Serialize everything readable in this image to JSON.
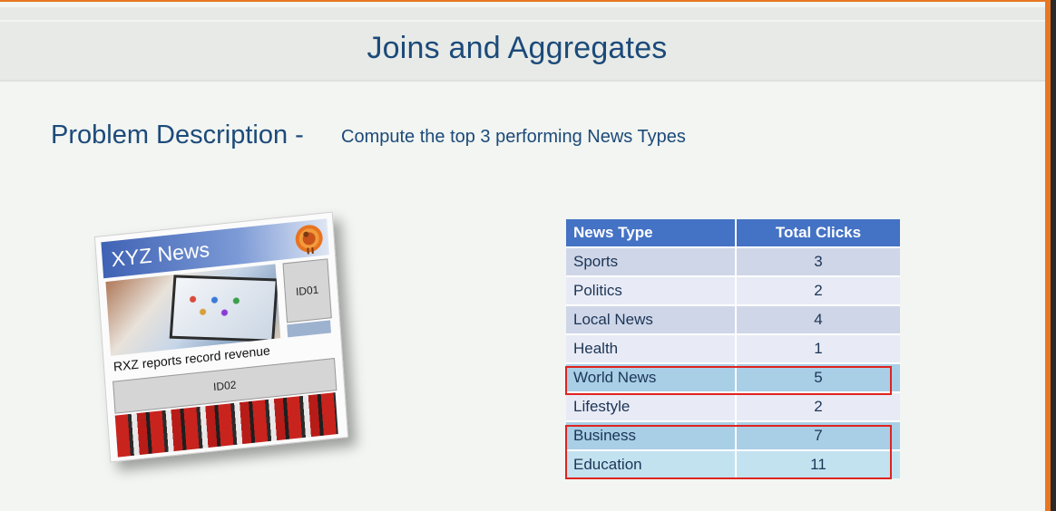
{
  "slide": {
    "title": "Joins and Aggregates",
    "problem_heading": "Problem Description -",
    "problem_text": "Compute the top 3 performing News Types"
  },
  "news_card": {
    "title": "XYZ News",
    "id_1": "ID01",
    "headline": "RXZ reports record revenue",
    "id_2": "ID02"
  },
  "table": {
    "headers": [
      "News Type",
      "Total Clicks"
    ],
    "rows": [
      {
        "type": "Sports",
        "clicks": "3"
      },
      {
        "type": "Politics",
        "clicks": "2"
      },
      {
        "type": "Local News",
        "clicks": "4"
      },
      {
        "type": "Health",
        "clicks": "1"
      },
      {
        "type": "World News",
        "clicks": "5"
      },
      {
        "type": "Lifestyle",
        "clicks": "2"
      },
      {
        "type": "Business",
        "clicks": "7"
      },
      {
        "type": "Education",
        "clicks": "11"
      }
    ],
    "highlighted_rows": [
      "World News",
      "Business",
      "Education"
    ]
  },
  "colors": {
    "accent": "#e87722",
    "title_text": "#1c4a7a",
    "table_header": "#4472c4",
    "highlight_border": "#e0231f"
  }
}
